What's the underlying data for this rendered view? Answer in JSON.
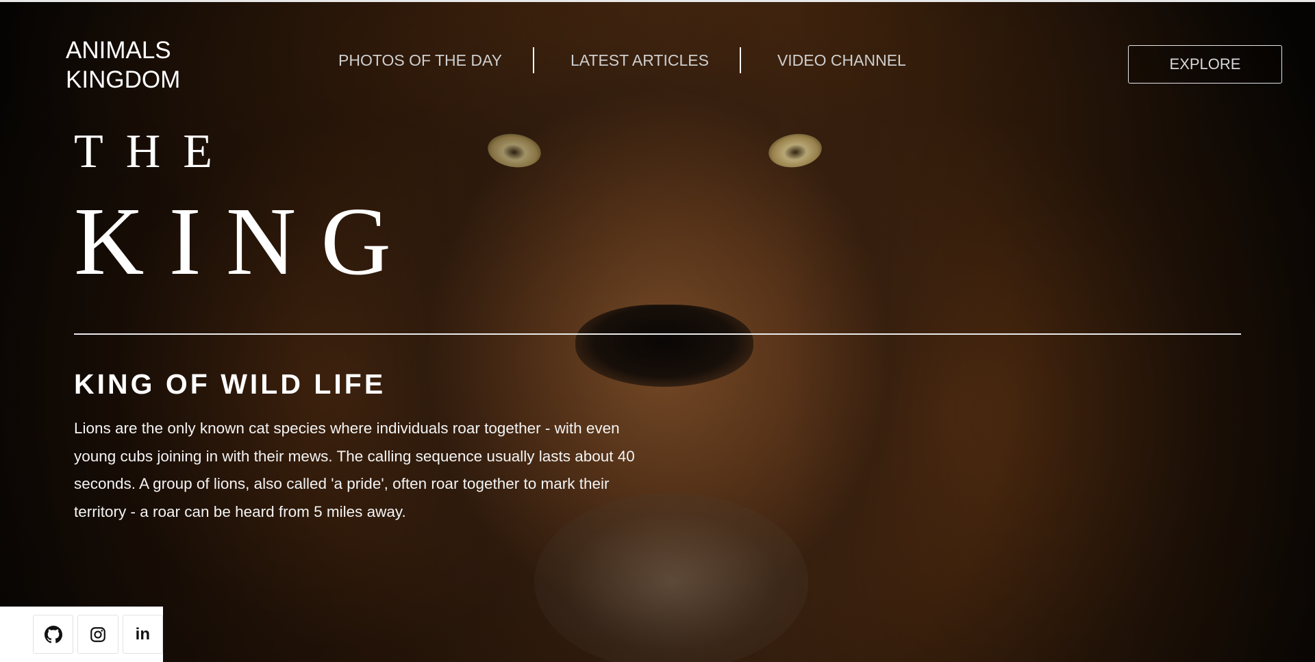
{
  "brand": {
    "line1": "ANIMALS",
    "line2": "KINGDOM"
  },
  "nav": {
    "items": [
      {
        "label": "PHOTOS OF THE DAY"
      },
      {
        "label": "LATEST ARTICLES"
      },
      {
        "label": "VIDEO CHANNEL"
      }
    ]
  },
  "header": {
    "explore_label": "EXPLORE"
  },
  "hero": {
    "the": "THE",
    "king": "KING",
    "subtitle": "KING OF WILD LIFE",
    "description": "Lions are the only known cat species where individuals roar together - with even young cubs joining in with their mews. The calling sequence usually lasts about 40 seconds. A group of lions, also called 'a pride', often roar together to mark their territory - a roar can be heard from 5 miles away."
  },
  "social": {
    "items": [
      {
        "icon": "github-icon"
      },
      {
        "icon": "instagram-icon"
      },
      {
        "icon": "linkedin-icon",
        "text": "in"
      }
    ]
  }
}
